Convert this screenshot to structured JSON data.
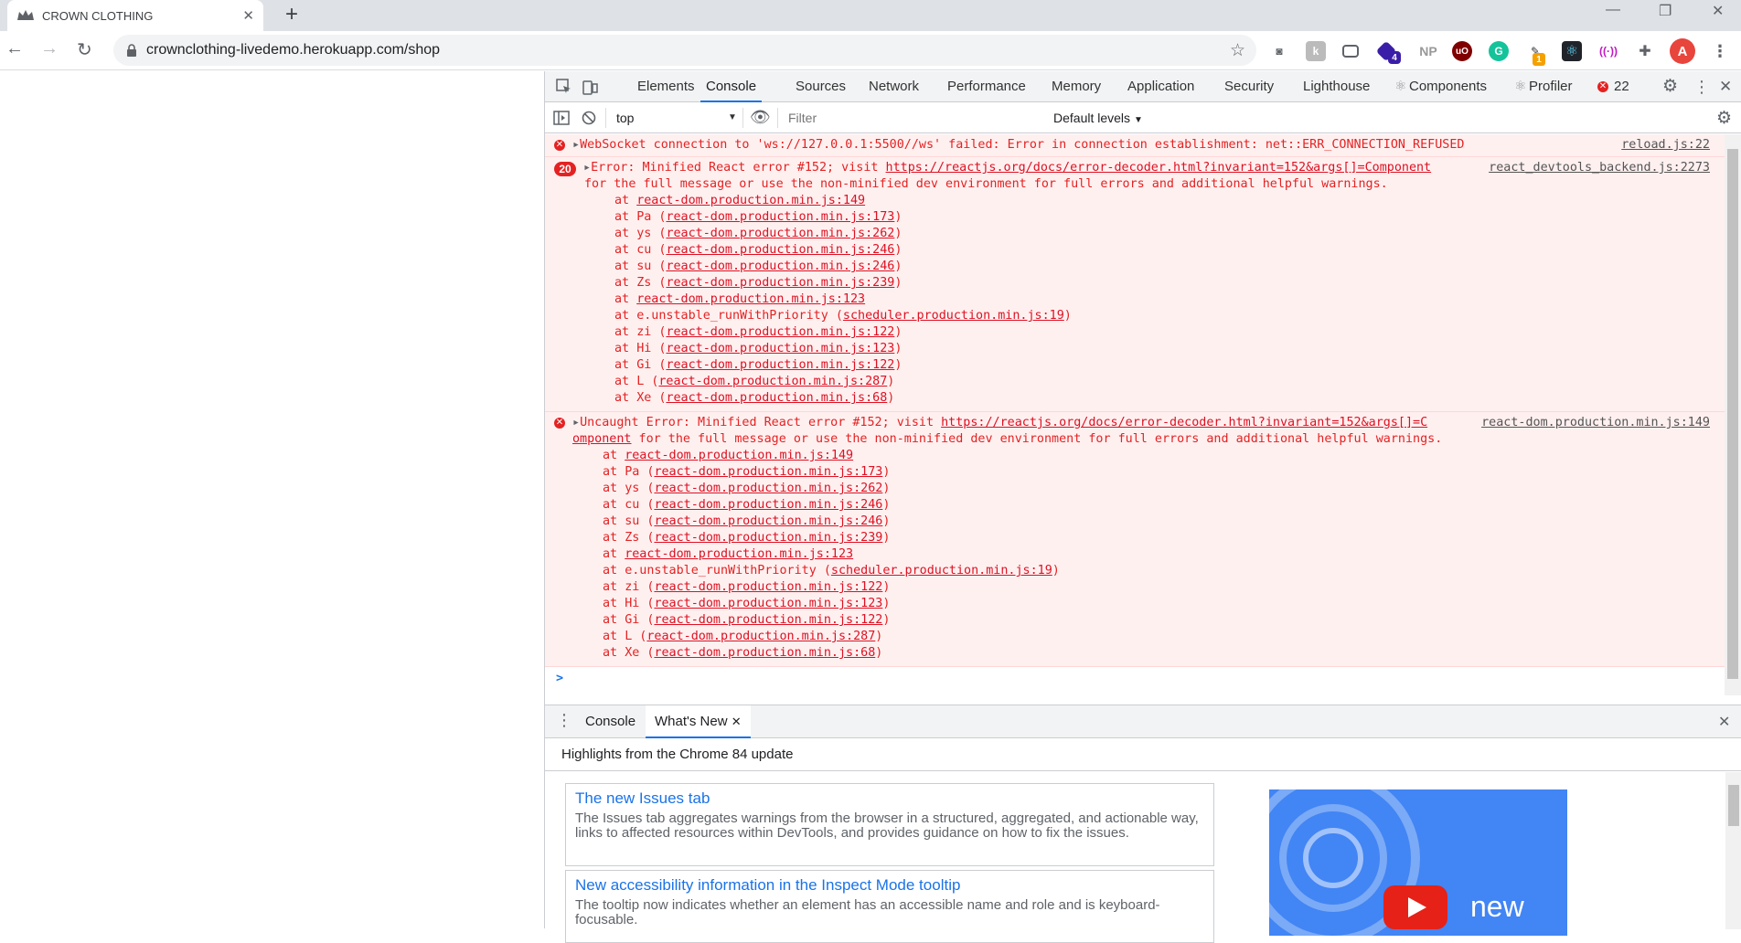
{
  "browser": {
    "tab_title": "CROWN CLOTHING",
    "url": "crownclothing-livedemo.herokuapp.com/shop",
    "extensions": [
      "camera-icon",
      "k-extension-icon",
      "cast-icon",
      "4",
      "NP",
      "uO",
      "grammarly-icon",
      "1",
      "react-icon",
      "cast-radio-icon",
      "puzzle-icon",
      "A"
    ]
  },
  "devtools": {
    "tabs": [
      "Elements",
      "Console",
      "Sources",
      "Network",
      "Performance",
      "Memory",
      "Application",
      "Security",
      "Lighthouse",
      "Components",
      "Profiler"
    ],
    "error_count": "22",
    "context": "top",
    "filter_placeholder": "Filter",
    "levels": "Default levels",
    "messages": {
      "ws": {
        "text": "WebSocket connection to 'ws://127.0.0.1:5500//ws' failed: Error in connection establishment: net::ERR_CONNECTION_REFUSED",
        "source": "reload.js:22"
      },
      "err1": {
        "count": "20",
        "text_prefix": "Error: Minified React error #152; visit ",
        "link": "https://reactjs.org/docs/error-decoder.html?invariant=152&args[]=Component",
        "source": "react_devtools_backend.js:2273",
        "line2": "for the full message or use the non-minified dev environment for full errors and additional helpful warnings."
      },
      "err2": {
        "text_prefix": "Uncaught Error: Minified React error #152; visit ",
        "link": "https://reactjs.org/docs/error-decoder.html?invariant=152&args[]=C",
        "source": "react-dom.production.min.js:149",
        "link_cont": "omponent",
        "line2": " for the full message or use the non-minified dev environment for full errors and additional helpful warnings."
      },
      "stack": [
        {
          "fn": "",
          "src": "react-dom.production.min.js:149"
        },
        {
          "fn": "Pa",
          "src": "react-dom.production.min.js:173"
        },
        {
          "fn": "ys",
          "src": "react-dom.production.min.js:262"
        },
        {
          "fn": "cu",
          "src": "react-dom.production.min.js:246"
        },
        {
          "fn": "su",
          "src": "react-dom.production.min.js:246"
        },
        {
          "fn": "Zs",
          "src": "react-dom.production.min.js:239"
        },
        {
          "fn": "",
          "src": "react-dom.production.min.js:123"
        },
        {
          "fn": "e.unstable_runWithPriority",
          "src": "scheduler.production.min.js:19"
        },
        {
          "fn": "zi",
          "src": "react-dom.production.min.js:122"
        },
        {
          "fn": "Hi",
          "src": "react-dom.production.min.js:123"
        },
        {
          "fn": "Gi",
          "src": "react-dom.production.min.js:122"
        },
        {
          "fn": "L",
          "src": "react-dom.production.min.js:287"
        },
        {
          "fn": "Xe",
          "src": "react-dom.production.min.js:68"
        }
      ]
    },
    "prompt": ">",
    "drawer": {
      "tabs": [
        "Console",
        "What's New"
      ],
      "header": "Highlights from the Chrome 84 update",
      "cards": [
        {
          "title": "The new Issues tab",
          "desc": "The Issues tab aggregates warnings from the browser in a structured, aggregated, and actionable way, links to affected resources within DevTools, and provides guidance on how to fix the issues."
        },
        {
          "title": "New accessibility information in the Inspect Mode tooltip",
          "desc": "The tooltip now indicates whether an element has an accessible name and role and is keyboard-focusable."
        }
      ],
      "video_label": "new"
    }
  }
}
